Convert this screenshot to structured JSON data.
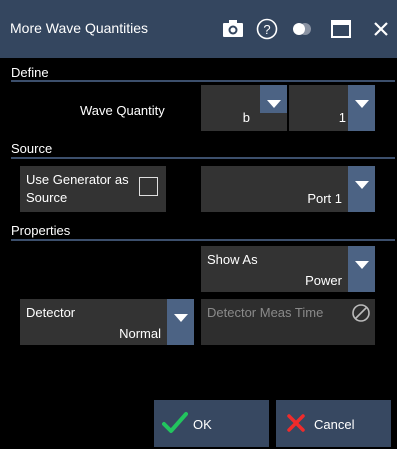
{
  "dialog": {
    "title": "More Wave Quantities",
    "icons": [
      "camera-icon",
      "help-icon",
      "toggle-icon",
      "maximize-icon",
      "close-icon"
    ]
  },
  "define": {
    "section_label": "Define",
    "wave_quantity_label": "Wave Quantity",
    "wave_value": "b",
    "index_value": "1"
  },
  "source": {
    "section_label": "Source",
    "use_generator_label_line1": "Use Generator as",
    "use_generator_label_line2": "Source",
    "use_generator_checked": false,
    "port_value": "Port 1"
  },
  "properties": {
    "section_label": "Properties",
    "show_as_label": "Show As",
    "show_as_value": "Power",
    "detector_label": "Detector",
    "detector_value": "Normal",
    "detector_meas_time_label": "Detector Meas Time"
  },
  "footer": {
    "ok_label": "OK",
    "cancel_label": "Cancel"
  },
  "colors": {
    "titlebar": "#34465f",
    "field_bg": "#333333",
    "dropdown_arrow_bg": "#4c6384",
    "ok_check": "#22c55e",
    "cancel_x": "#ef2b2b"
  }
}
